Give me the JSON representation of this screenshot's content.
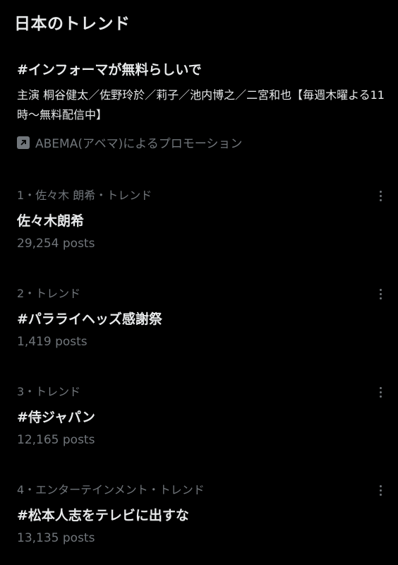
{
  "header": {
    "title": "日本のトレンド"
  },
  "promoted": {
    "title": "#インフォーマが無料らしいで",
    "description": "主演 桐谷健太／佐野玲於／莉子／池内博之／二宮和也【毎週木曜よる11時～無料配信中】",
    "promoted_by": "ABEMA(アベマ)によるプロモーション",
    "icon": "promoted-arrow-icon"
  },
  "trends": [
    {
      "meta": "1・佐々木 朗希・トレンド",
      "name": "佐々木朗希",
      "posts": "29,254 posts"
    },
    {
      "meta": "2・トレンド",
      "name": "#パラライヘッズ感謝祭",
      "posts": "1,419 posts"
    },
    {
      "meta": "3・トレンド",
      "name": "#侍ジャパン",
      "posts": "12,165 posts"
    },
    {
      "meta": "4・エンターテインメント・トレンド",
      "name": "#松本人志をテレビに出すな",
      "posts": "13,135 posts"
    }
  ],
  "colors": {
    "background": "#000000",
    "primary_text": "#e7e9ea",
    "secondary_text": "#71767b"
  }
}
